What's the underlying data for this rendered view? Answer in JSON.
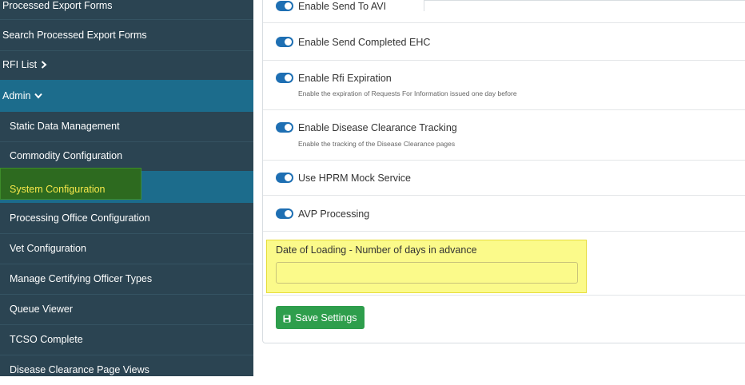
{
  "sidebar": {
    "items": [
      {
        "label": "Processed Export Forms"
      },
      {
        "label": "Search Processed Export Forms"
      },
      {
        "label": "RFI List",
        "chevron": "chevron-right-icon"
      },
      {
        "label": "Admin",
        "chevron": "chevron-down-icon"
      },
      {
        "label": "Static Data Management"
      },
      {
        "label": "Commodity Configuration"
      },
      {
        "label": "System Configuration",
        "active": true
      },
      {
        "label": "Processing Office Configuration"
      },
      {
        "label": "Vet Configuration"
      },
      {
        "label": "Manage Certifying Officer Types"
      },
      {
        "label": "Queue Viewer"
      },
      {
        "label": "TCSO Complete"
      },
      {
        "label": "Disease Clearance Page Views"
      }
    ],
    "colors": {
      "background": "#2b4452",
      "admin_bg": "#1c6c8c",
      "active_text": "#f7e84a"
    }
  },
  "settings": [
    {
      "label": "Enable Send To AVI",
      "enabled": true
    },
    {
      "label": "Enable Send Completed EHC",
      "enabled": true
    },
    {
      "label": "Enable Rfi Expiration",
      "enabled": true,
      "description": "Enable the expiration of Requests For Information issued one day before"
    },
    {
      "label": "Enable Disease Clearance Tracking",
      "enabled": true,
      "description": "Enable the tracking of the Disease Clearance pages"
    },
    {
      "label": "Use HPRM Mock Service",
      "enabled": true
    },
    {
      "label": "AVP Processing",
      "enabled": true
    }
  ],
  "date_of_loading": {
    "label": "Date of Loading - Number of days in advance",
    "value": ""
  },
  "save_button": {
    "label": "Save Settings",
    "icon": "save-icon",
    "color": "#2e9e4c"
  },
  "toggle_color": "#1e6fb3"
}
